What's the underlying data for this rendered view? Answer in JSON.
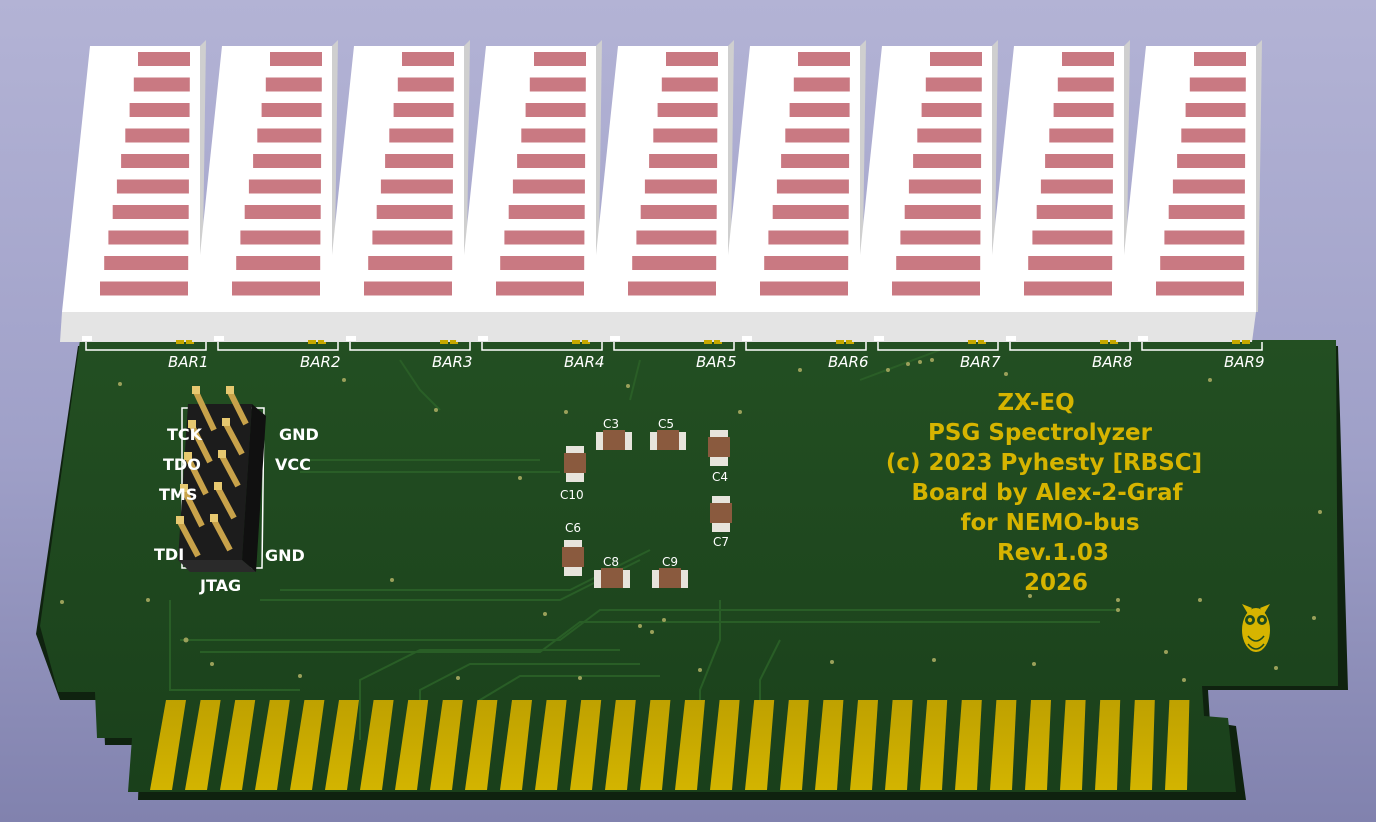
{
  "board_text": {
    "lines": [
      "ZX-EQ",
      "PSG Spectrolyzer",
      "(c) 2023 Pyhesty [RBSC]",
      "Board by Alex-2-Graf",
      "for NEMO-bus",
      "Rev.1.03",
      "2026"
    ]
  },
  "bar_labels": [
    "BAR1",
    "BAR2",
    "BAR3",
    "BAR4",
    "BAR5",
    "BAR6",
    "BAR7",
    "BAR8",
    "BAR9"
  ],
  "bar_segments": 10,
  "jtag": {
    "title": "JTAG",
    "left": [
      "TCK",
      "TDO",
      "TMS",
      "TDI"
    ],
    "right": [
      "GND",
      "VCC",
      "GND"
    ]
  },
  "capacitors": [
    "C3",
    "C5",
    "C4",
    "C10",
    "C6",
    "C7",
    "C8",
    "C9"
  ],
  "edge_contacts": 30,
  "colors": {
    "pcb": "#1e4a1e",
    "silkscreen_text": "#d6b400",
    "gold": "#c8a800",
    "bar_segment": "#c97982"
  },
  "icons": [
    "owl-logo-icon"
  ]
}
